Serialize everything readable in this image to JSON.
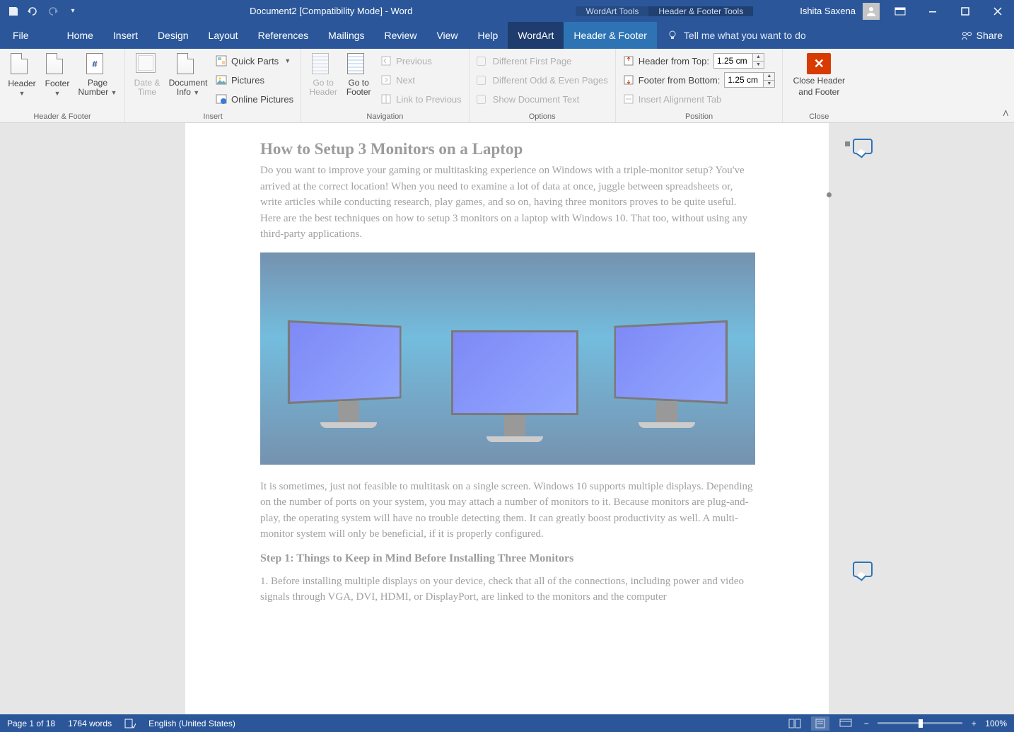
{
  "titlebar": {
    "doc_title": "Document2 [Compatibility Mode] - Word",
    "ctx_wordart": "WordArt Tools",
    "ctx_hft": "Header & Footer Tools",
    "user_name": "Ishita Saxena"
  },
  "tabs": {
    "file": "File",
    "home": "Home",
    "insert": "Insert",
    "design": "Design",
    "layout": "Layout",
    "references": "References",
    "mailings": "Mailings",
    "review": "Review",
    "view": "View",
    "help": "Help",
    "wordart": "WordArt",
    "header_footer": "Header & Footer",
    "tellme": "Tell me what you want to do",
    "share": "Share"
  },
  "ribbon": {
    "g_header_footer": {
      "label": "Header & Footer",
      "header": "Header",
      "footer": "Footer",
      "pagenum": "Page Number"
    },
    "g_insert": {
      "label": "Insert",
      "date_time": "Date & Time",
      "doc_info": "Document Info",
      "quick_parts": "Quick Parts",
      "pictures": "Pictures",
      "online_pictures": "Online Pictures"
    },
    "g_navigation": {
      "label": "Navigation",
      "goto_header": "Go to Header",
      "goto_footer": "Go to Footer",
      "previous": "Previous",
      "next": "Next",
      "link_prev": "Link to Previous"
    },
    "g_options": {
      "label": "Options",
      "diff_first": "Different First Page",
      "diff_oe": "Different Odd & Even Pages",
      "show_doc": "Show Document Text"
    },
    "g_position": {
      "label": "Position",
      "header_from_top": "Header from Top:",
      "footer_from_bottom": "Footer from Bottom:",
      "insert_align": "Insert Alignment Tab",
      "header_val": "1.25 cm",
      "footer_val": "1.25 cm"
    },
    "g_close": {
      "label": "Close",
      "close1": "Close Header",
      "close2": "and Footer"
    }
  },
  "document": {
    "h1": "How to Setup 3 Monitors on a Laptop",
    "p1": "Do you want to improve your gaming or multitasking experience on Windows with a triple-monitor setup? You've arrived at the correct location! When you need to examine a lot of data at once, juggle between spreadsheets or, write articles while conducting research, play games, and so on, having three monitors proves to be quite useful. Here are the best techniques on how to setup 3 monitors on a laptop with Windows 10. That too, without using any third-party applications.",
    "p2": "It is sometimes, just not feasible to multitask on a single screen. Windows 10 supports multiple displays. Depending on the number of ports on your system, you may attach a number of monitors to it. Because monitors are plug-and-play, the operating system will have no trouble detecting them. It can greatly boost productivity as well. A multi-monitor system will only be beneficial, if it is properly configured.",
    "step1": "Step 1: Things to Keep in Mind Before Installing Three Monitors",
    "p3": "1. Before installing multiple displays on your device, check that all of the connections, including power and video signals through VGA, DVI, HDMI, or DisplayPort, are linked to the monitors and the computer"
  },
  "statusbar": {
    "page": "Page 1 of 18",
    "words": "1764 words",
    "lang": "English (United States)",
    "zoom": "100%"
  }
}
